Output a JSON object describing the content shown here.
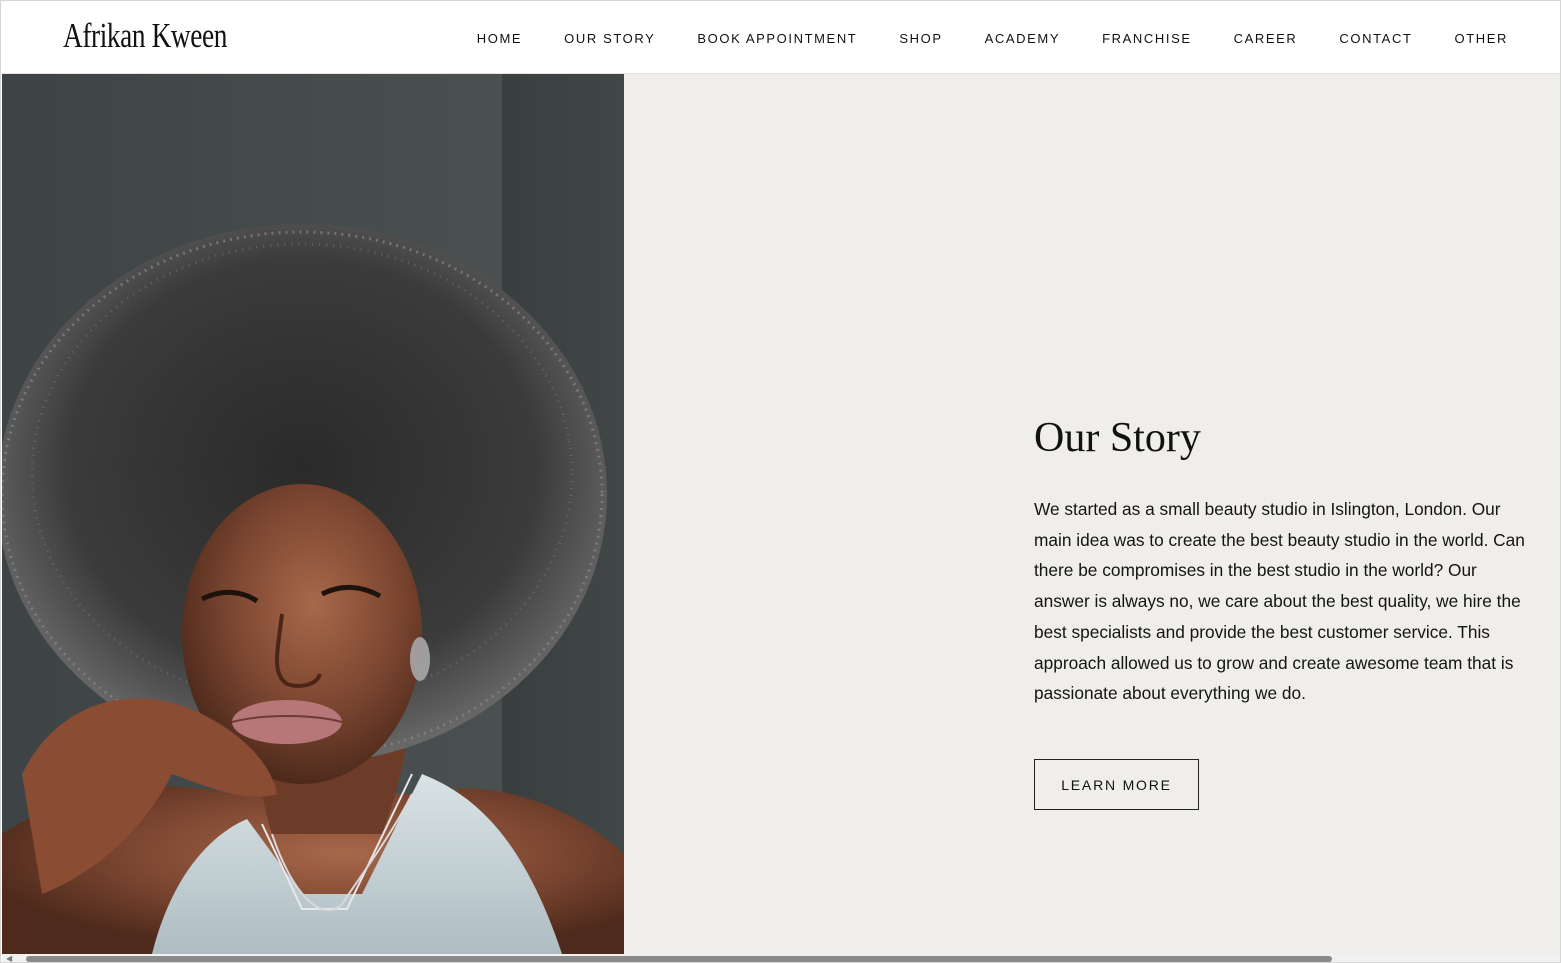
{
  "header": {
    "logo": "Afrikan Kween",
    "nav": [
      {
        "label": "HOME"
      },
      {
        "label": "OUR STORY"
      },
      {
        "label": "BOOK APPOINTMENT"
      },
      {
        "label": "SHOP"
      },
      {
        "label": "ACADEMY"
      },
      {
        "label": "FRANCHISE"
      },
      {
        "label": "CAREER"
      },
      {
        "label": "CONTACT"
      },
      {
        "label": "OTHER"
      }
    ]
  },
  "story": {
    "title": "Our Story",
    "paragraph": "We started as a small beauty studio in Islington, London. Our main idea was to create the best beauty studio in the world. Can there be compromises in the best studio in the world? Our answer is always no, we care about the best quality, we hire the best specialists and provide the best customer service. This approach allowed us to grow and create awesome team that is passionate about everything we do.",
    "button_label": "LEARN MORE"
  },
  "colors": {
    "panel_background": "#f0eeea",
    "header_background": "#ffffff",
    "text": "#111111"
  },
  "icons": {
    "scroll_left": "scroll-left-arrow-icon"
  }
}
